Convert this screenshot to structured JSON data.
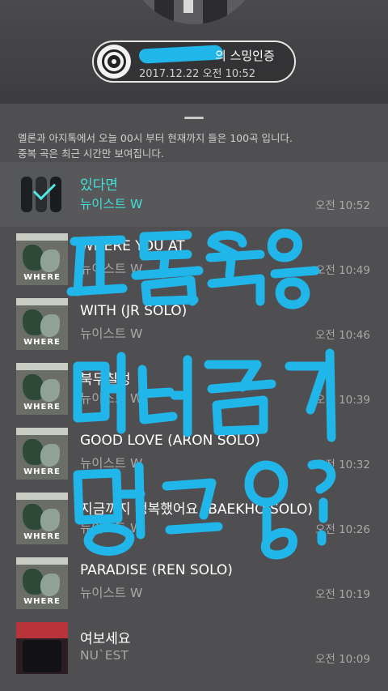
{
  "badge": {
    "title": "의 스밍인증",
    "datetime": "2017.12.22 오전 10:52"
  },
  "notice": {
    "line1": "멜론과 아지톡에서 오늘 00시 부터 현재까지 들은 100곡 입니다.",
    "line2": "중복 곡은 최근 시간만 보여집니다."
  },
  "songs": [
    {
      "title": "있다면",
      "artist": "뉴이스트 W",
      "time": "오전 10:52",
      "current": true
    },
    {
      "title": "WHERE YOU AT",
      "artist": "뉴이스트 W",
      "time": "오전 10:49"
    },
    {
      "title": "WITH (JR SOLO)",
      "artist": "뉴이스트 W",
      "time": "오전 10:46"
    },
    {
      "title": "북두칠성",
      "artist": "뉴이스트 W",
      "time": "오전 10:39"
    },
    {
      "title": "GOOD LOVE (ARON SOLO)",
      "artist": "뉴이스트 W",
      "time": "오전 10:32"
    },
    {
      "title": "지금까지 행복했어요 (BAEKHO SOLO)",
      "artist": "뉴이스트 W",
      "time": "오전 10:26"
    },
    {
      "title": "PARADISE (REN SOLO)",
      "artist": "뉴이스트 W",
      "time": "오전 10:19"
    },
    {
      "title": "여보세요",
      "artist": "NU`EST",
      "time": "오전 10:09"
    }
  ],
  "cover_word": "WHERE",
  "colors": {
    "accent": "#3fe0d8",
    "marker": "#21b6e9",
    "sheet": "#4f4f51"
  }
}
